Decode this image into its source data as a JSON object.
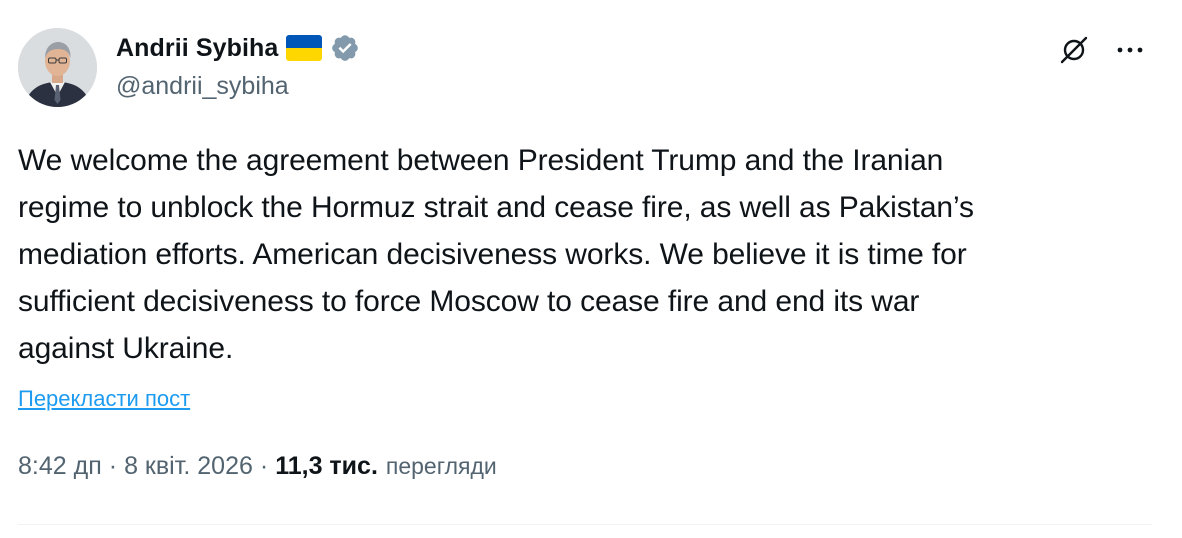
{
  "author": {
    "display_name": "Andrii Sybiha",
    "handle": "@andrii_sybiha",
    "flag_colors": [
      "#0057b7",
      "#ffd700"
    ],
    "verified_badge_color": "#829aab",
    "avatar_icon": "profile-photo"
  },
  "actions": {
    "grok_icon": "grok-icon",
    "more_icon": "more-icon"
  },
  "tweet": {
    "text": "We welcome the agreement between President Trump and the Iranian\nregime to unblock the Hormuz strait and cease fire, as well as Pakistan’s\nmediation efforts. American decisiveness works. We believe it is time for\nsufficient decisiveness to force Moscow to cease fire and end its war\nagainst Ukraine.",
    "translate_label": "Перекласти пост"
  },
  "meta": {
    "time": "8:42 дп",
    "separator": "·",
    "date": "8 квіт. 2026",
    "views_count": "11,3 тис.",
    "views_label": "перегляди"
  },
  "colors": {
    "text": "#0f1419",
    "secondary": "#536471",
    "link": "#1d9bf0",
    "divider": "#eff3f4"
  }
}
